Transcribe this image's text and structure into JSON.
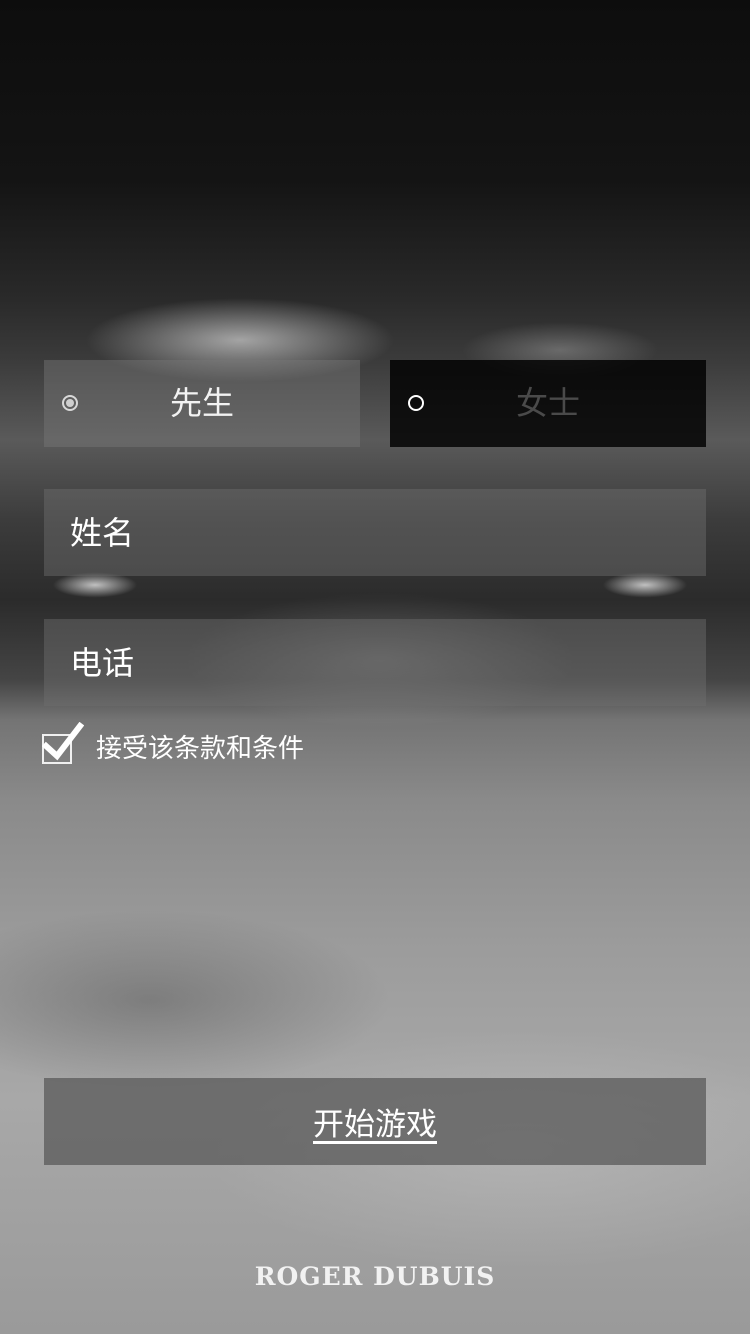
{
  "gender": {
    "options": [
      {
        "label": "先生",
        "selected": true
      },
      {
        "label": "女士",
        "selected": false
      }
    ]
  },
  "form": {
    "name_placeholder": "姓名",
    "phone_placeholder": "电话",
    "terms_label": "接受该条款和条件",
    "terms_checked": true
  },
  "actions": {
    "start_label": "开始游戏"
  },
  "brand": {
    "logo_text": "ROGER DUBUIS"
  },
  "colors": {
    "selected_panel": "#6e6e6e",
    "unselected_panel": "#0a0a0a",
    "field_bg": "#6e6e6e",
    "button_bg": "#5a5a5a",
    "text": "#ffffff"
  }
}
